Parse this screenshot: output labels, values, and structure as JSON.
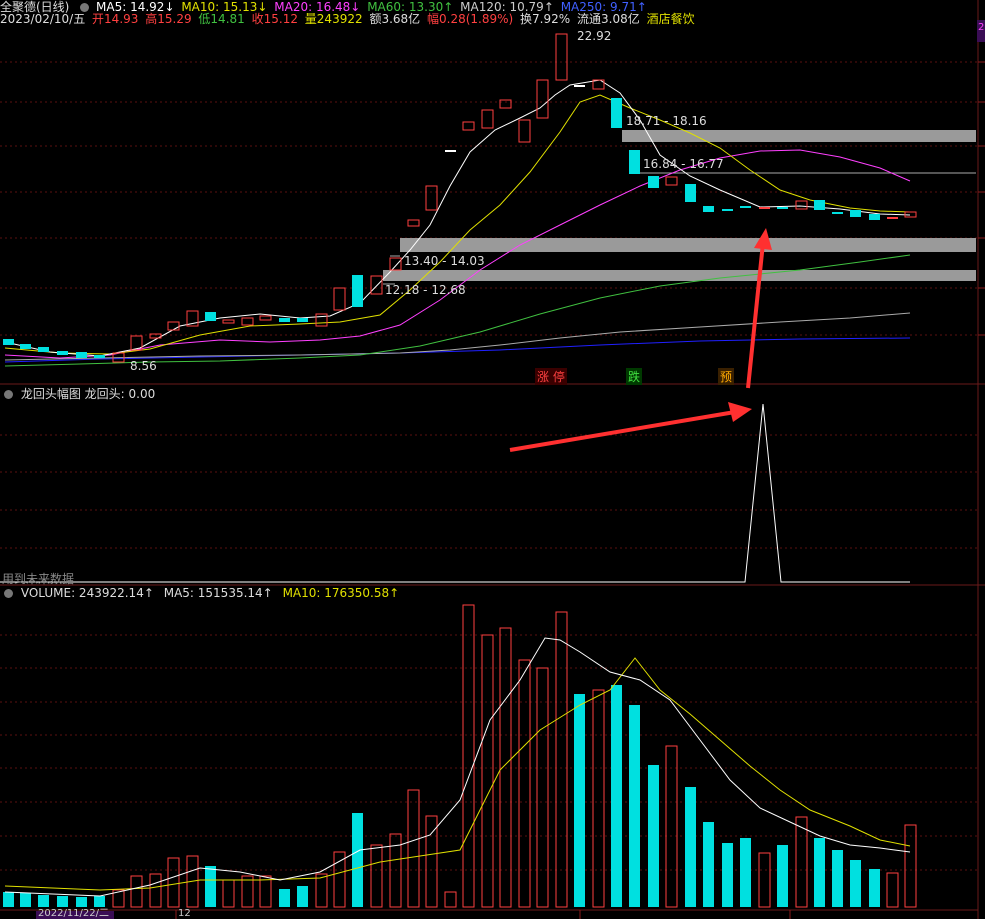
{
  "header": {
    "stock_name": "全聚德(日线)",
    "ma5": "MA5: 14.92↓",
    "ma10": "MA10: 15.13↓",
    "ma20": "MA20: 16.48↓",
    "ma60": "MA60: 13.30↑",
    "ma120": "MA120: 10.79↑",
    "ma250": "MA250: 9.71↑"
  },
  "quote": {
    "date": "2023/02/10/五",
    "open": "开14.93",
    "high": "高15.29",
    "low": "低14.81",
    "close": "收15.12",
    "volume": "量243922",
    "amount": "额3.68亿",
    "change": "幅0.28(1.89%)",
    "turnover": "换7.92%",
    "float_cap": "流通3.08亿",
    "sector": "酒店餐饮"
  },
  "annotations": {
    "peak": "22.92",
    "low": "8.56",
    "zone1": "18.71 - 18.16",
    "zone2": "16.84 - 16.77",
    "zone3": "13.40 - 14.03",
    "zone4": "12.18 - 12.68",
    "tag_limit_up": "涨 停",
    "tag_fall": "跌",
    "tag_pre": "预",
    "right_badge": "2"
  },
  "indicator": {
    "title": "龙回头幅图",
    "value": "龙回头: 0.00",
    "warning": "用到未来数据"
  },
  "volume_panel": {
    "volume": "VOLUME: 243922.14↑",
    "ma5": "MA5: 151535.14↑",
    "ma10": "MA10: 176350.58↑"
  },
  "footer": {
    "date_label": "2022/11/22/二",
    "marker": "12"
  },
  "colors": {
    "up": "#ff4040",
    "down": "#00e0e0",
    "ma5": "#ffffff",
    "ma10": "#e0e000",
    "ma20": "#ff40ff",
    "ma60": "#40c040",
    "ma120": "#aaaaaa",
    "ma250": "#2020ff",
    "arrow": "#ff3030"
  }
}
